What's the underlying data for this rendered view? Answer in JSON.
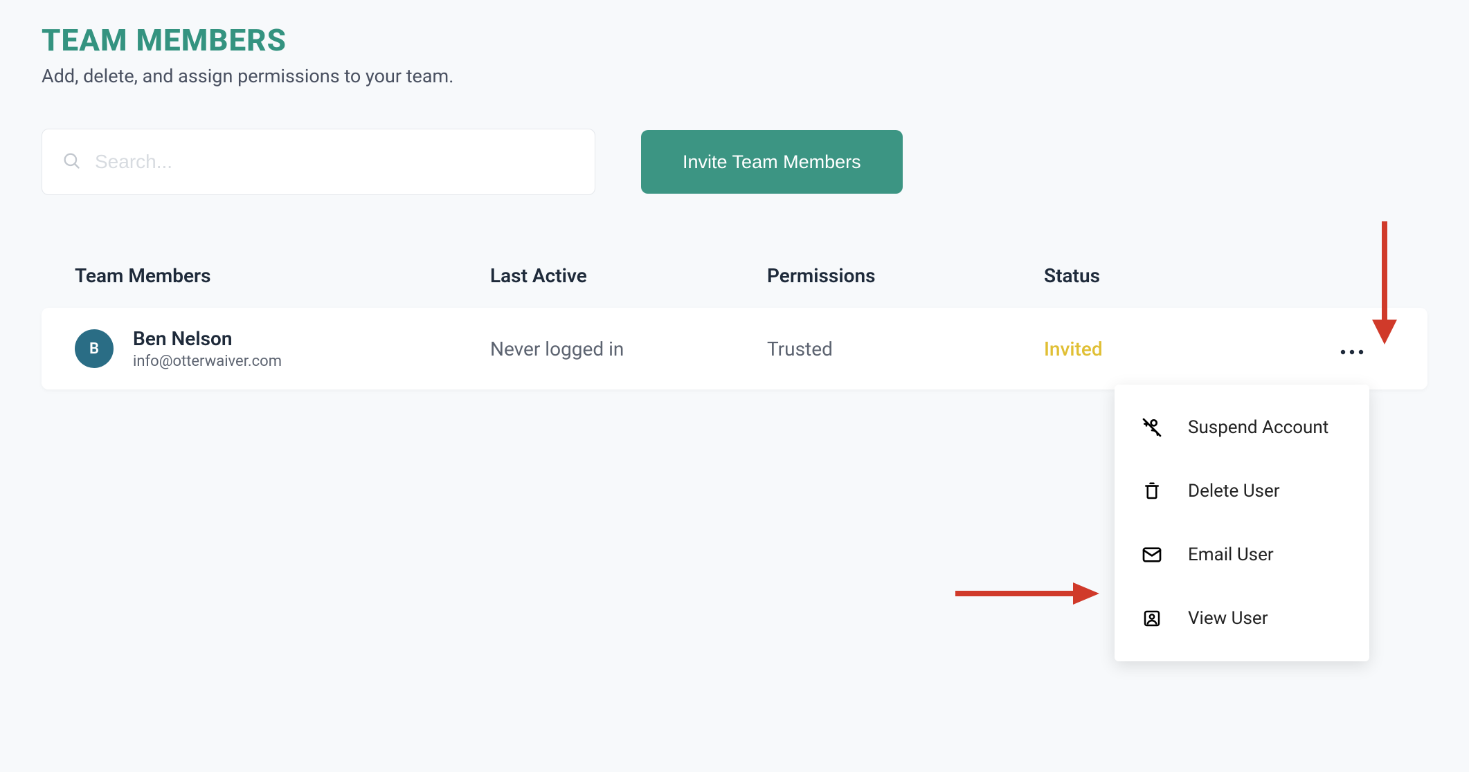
{
  "header": {
    "title": "TEAM MEMBERS",
    "subtitle": "Add, delete, and assign permissions to your team."
  },
  "controls": {
    "search_placeholder": "Search...",
    "invite_button": "Invite Team Members"
  },
  "table": {
    "columns": {
      "members": "Team Members",
      "last_active": "Last Active",
      "permissions": "Permissions",
      "status": "Status"
    },
    "rows": [
      {
        "avatar_initial": "B",
        "name": "Ben Nelson",
        "email": "info@otterwaiver.com",
        "last_active": "Never logged in",
        "permissions": "Trusted",
        "status": "Invited"
      }
    ]
  },
  "dropdown": {
    "suspend": "Suspend Account",
    "delete": "Delete User",
    "email": "Email User",
    "view": "View User"
  },
  "colors": {
    "accent": "#3c9583",
    "status_invited": "#e0bf34",
    "avatar_bg": "#2a6d85"
  }
}
